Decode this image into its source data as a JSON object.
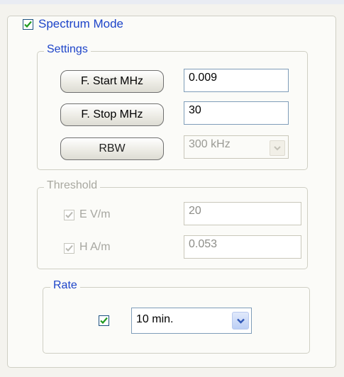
{
  "spectrum_mode": {
    "label": "Spectrum Mode",
    "checked": true
  },
  "settings": {
    "title": "Settings",
    "f_start_button": "F. Start MHz",
    "f_start_value": "0.009",
    "f_stop_button": "F. Stop MHz",
    "f_stop_value": "30",
    "rbw_button": "RBW",
    "rbw_value": "300 kHz"
  },
  "threshold": {
    "title": "Threshold",
    "e_label": "E V/m",
    "e_value": "20",
    "h_label": "H A/m",
    "h_value": "0.053"
  },
  "rate": {
    "title": "Rate",
    "checked": true,
    "value": "10 min."
  },
  "colors": {
    "legend_text": "#1d44c9",
    "check_mark": "#1f9a1f",
    "disabled_text": "#a6a6a0"
  }
}
